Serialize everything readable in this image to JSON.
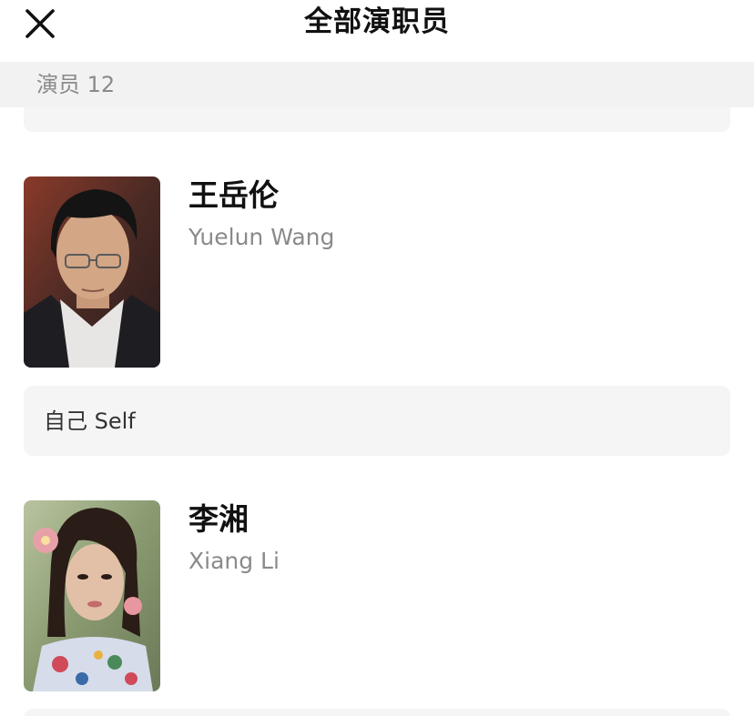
{
  "header": {
    "title": "全部演职员",
    "close_icon": "close-icon"
  },
  "section": {
    "label": "演员 12"
  },
  "cast": [
    {
      "name_cn": "王岳伦",
      "name_en": "Yuelun Wang",
      "role": "自己 Self",
      "photo_icon": "portrait-photo"
    },
    {
      "name_cn": "李湘",
      "name_en": "Xiang Li",
      "photo_icon": "portrait-photo"
    }
  ],
  "colors": {
    "section_bg": "#f2f2f2",
    "role_bg": "#f5f5f5",
    "secondary_text": "#8a8a8a",
    "primary_text": "#111111"
  }
}
